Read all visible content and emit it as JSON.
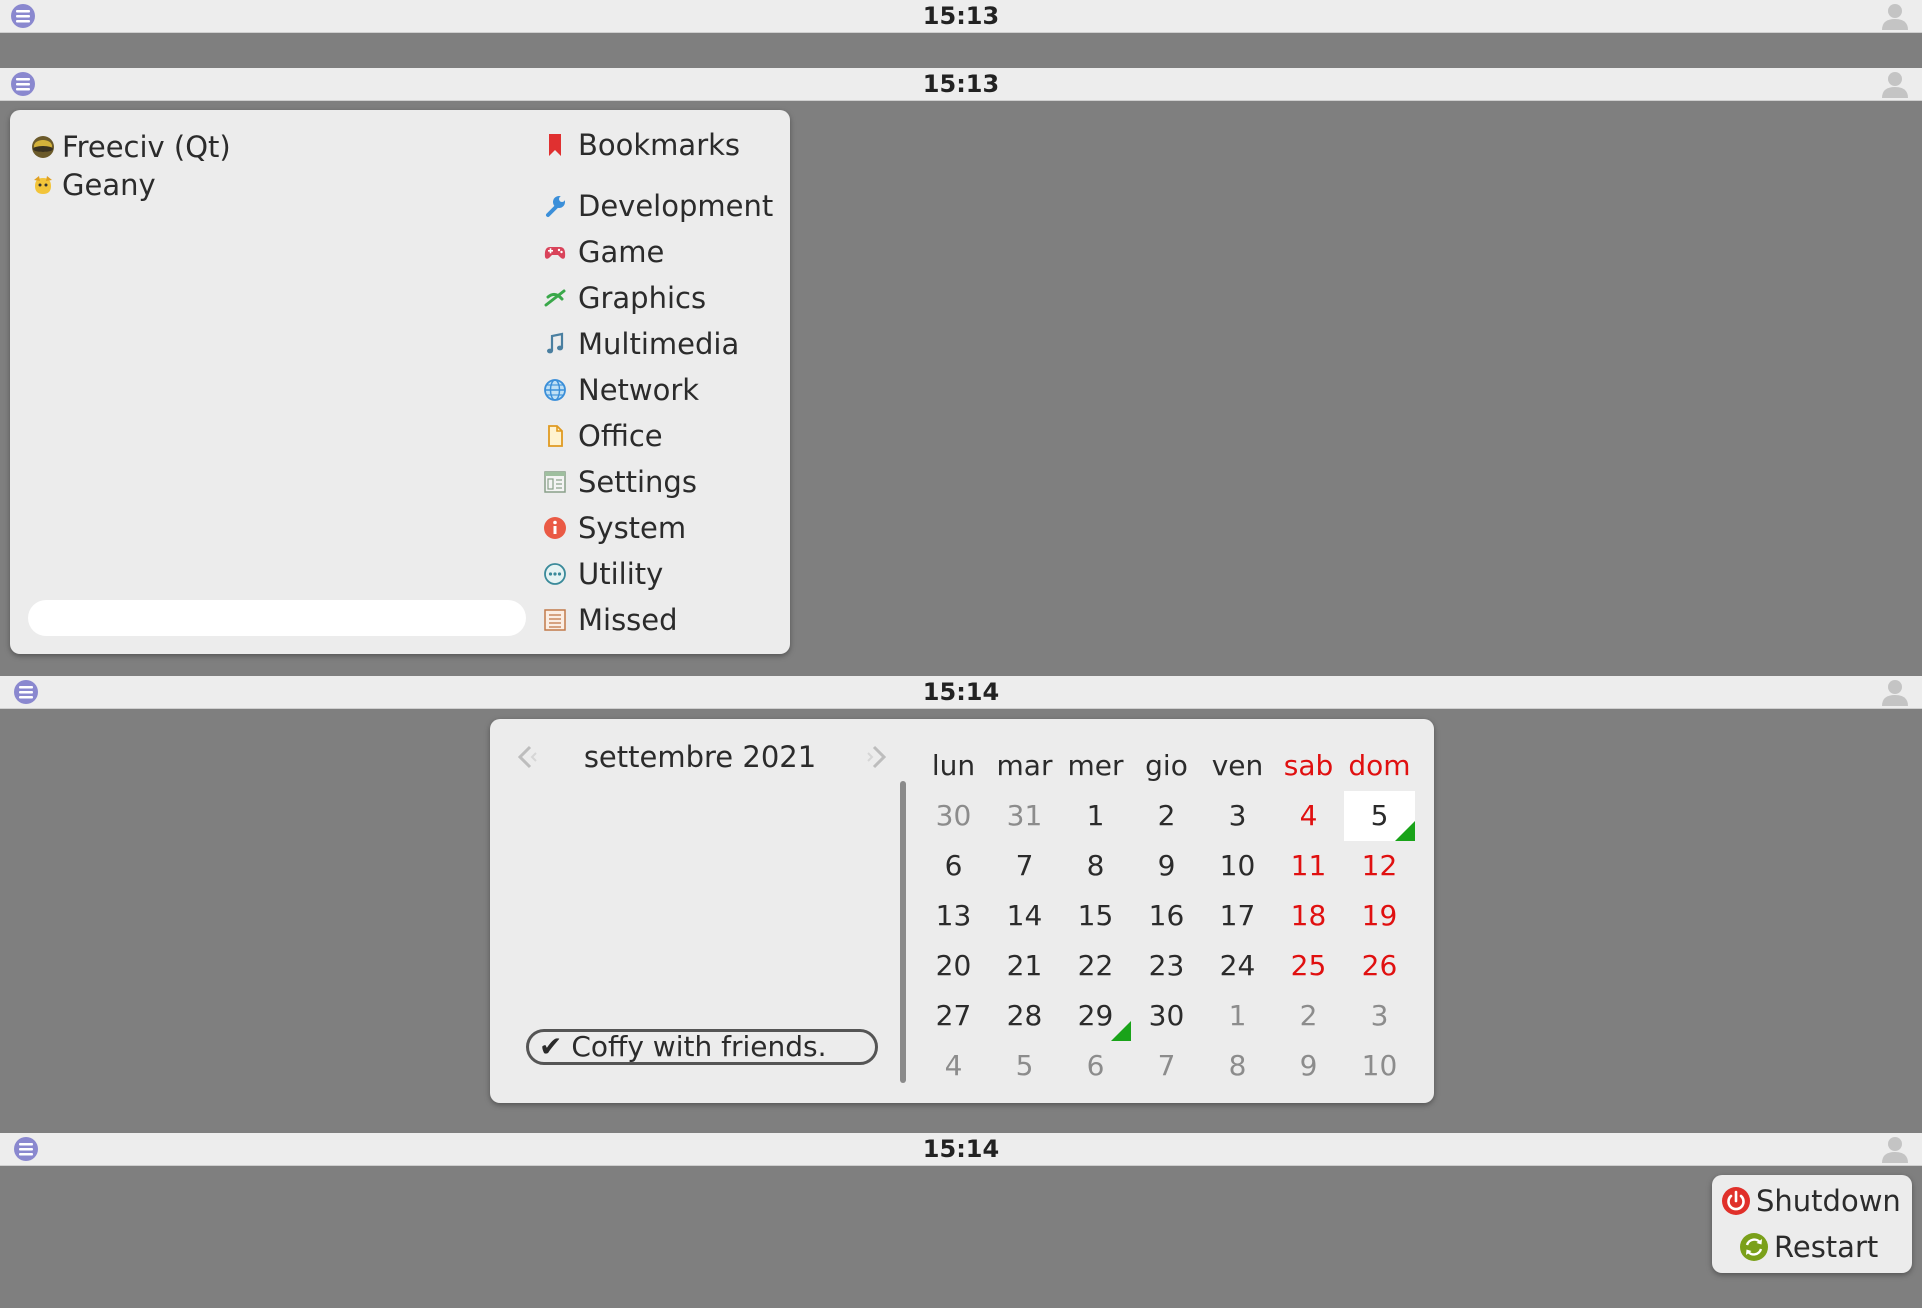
{
  "panels": [
    {
      "clock": "15:13"
    },
    {
      "clock": "15:13"
    },
    {
      "clock": "15:14"
    },
    {
      "clock": "15:14"
    }
  ],
  "app_menu": {
    "favorites": [
      {
        "label": "Freeciv (Qt)",
        "icon": "freeciv-icon"
      },
      {
        "label": "Geany",
        "icon": "geany-icon"
      }
    ],
    "search": {
      "value": "",
      "placeholder": ""
    },
    "categories": [
      {
        "label": "Bookmarks",
        "icon": "bookmark-icon"
      },
      {
        "label": "Development",
        "icon": "wrench-icon"
      },
      {
        "label": "Game",
        "icon": "gamepad-icon"
      },
      {
        "label": "Graphics",
        "icon": "graphics-icon"
      },
      {
        "label": "Multimedia",
        "icon": "music-note-icon"
      },
      {
        "label": "Network",
        "icon": "globe-icon"
      },
      {
        "label": "Office",
        "icon": "document-icon"
      },
      {
        "label": "Settings",
        "icon": "settings-icon"
      },
      {
        "label": "System",
        "icon": "info-icon"
      },
      {
        "label": "Utility",
        "icon": "utility-icon"
      },
      {
        "label": "Missed",
        "icon": "list-icon"
      }
    ]
  },
  "calendar": {
    "month_label": "settembre 2021",
    "event_label": "✔ Coffy with friends.",
    "weekdays": [
      "lun",
      "mar",
      "mer",
      "gio",
      "ven",
      "sab",
      "dom"
    ],
    "weeks": [
      [
        "30",
        "31",
        "1",
        "2",
        "3",
        "4",
        "5"
      ],
      [
        "6",
        "7",
        "8",
        "9",
        "10",
        "11",
        "12"
      ],
      [
        "13",
        "14",
        "15",
        "16",
        "17",
        "18",
        "19"
      ],
      [
        "20",
        "21",
        "22",
        "23",
        "24",
        "25",
        "26"
      ],
      [
        "27",
        "28",
        "29",
        "30",
        "1",
        "2",
        "3"
      ],
      [
        "4",
        "5",
        "6",
        "7",
        "8",
        "9",
        "10"
      ]
    ],
    "today": "5",
    "days_with_events": [
      "5",
      "29"
    ],
    "colors": {
      "weekend": "#e01010",
      "event_marker": "#19a319",
      "other_month": "#8c8c8c"
    }
  },
  "power_menu": {
    "items": [
      {
        "label": "Shutdown",
        "icon": "power-icon"
      },
      {
        "label": "Restart",
        "icon": "restart-icon"
      }
    ]
  }
}
